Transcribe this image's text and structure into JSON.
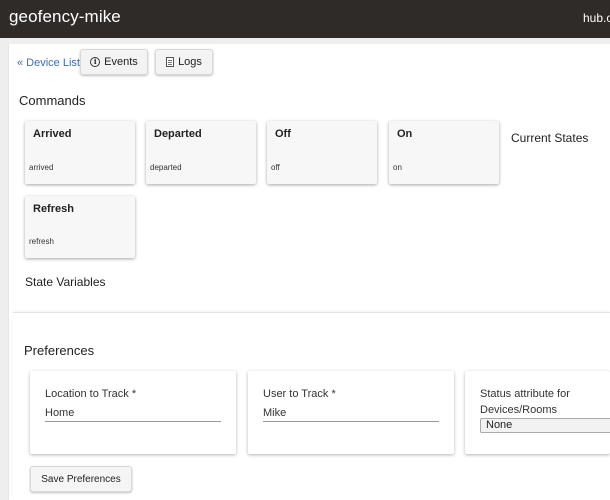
{
  "header": {
    "title": "geofency-mike",
    "host": "hub.c"
  },
  "nav": {
    "back_label": "« Device List",
    "events_label": "Events",
    "logs_label": "Logs"
  },
  "commands": {
    "title": "Commands",
    "items": [
      {
        "name": "Arrived",
        "value": "arrived"
      },
      {
        "name": "Departed",
        "value": "departed"
      },
      {
        "name": "Off",
        "value": "off"
      },
      {
        "name": "On",
        "value": "on"
      },
      {
        "name": "Refresh",
        "value": "refresh"
      }
    ]
  },
  "current_states": {
    "title": "Current States"
  },
  "state_variables": {
    "title": "State Variables"
  },
  "preferences": {
    "title": "Preferences",
    "location": {
      "label": "Location to Track *",
      "value": "Home"
    },
    "user": {
      "label": "User to Track *",
      "value": "Mike"
    },
    "status_attribute": {
      "label": "Status attribute for Devices/Rooms",
      "value": "None"
    },
    "save_label": "Save Preferences"
  }
}
